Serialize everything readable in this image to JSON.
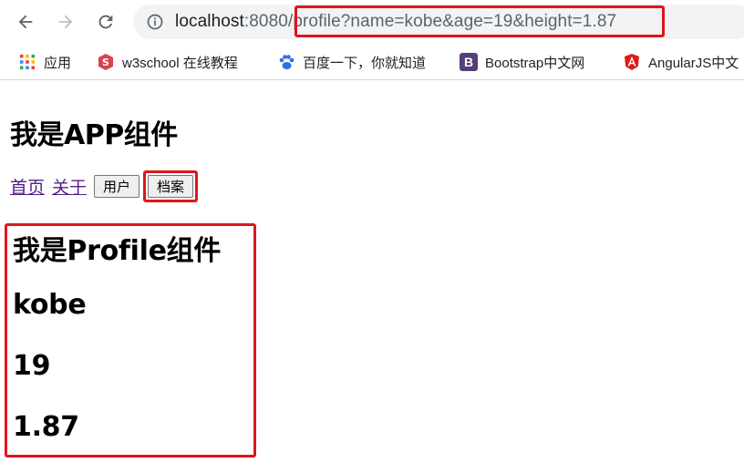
{
  "browser": {
    "url": {
      "host": "localhost",
      "port": ":8080",
      "path": "/profile?name=kobe&age=19&height=1.87"
    },
    "bookmarks": [
      {
        "label": "应用",
        "icon": "apps-grid-icon"
      },
      {
        "label": "w3school 在线教程",
        "icon": "w3school-icon"
      },
      {
        "label": "百度一下，你就知道",
        "icon": "baidu-paw-icon"
      },
      {
        "label": "Bootstrap中文网",
        "icon": "bootstrap-icon",
        "badge": "B"
      },
      {
        "label": "AngularJS中文",
        "icon": "angular-icon"
      }
    ]
  },
  "app": {
    "title": "我是APP组件",
    "nav": {
      "home": "首页",
      "about": "关于",
      "user_button": "用户",
      "profile_button": "档案"
    }
  },
  "profile": {
    "title": "我是Profile组件",
    "name": "kobe",
    "age": "19",
    "height": "1.87"
  },
  "colors": {
    "highlight": "#e0151d",
    "visited_link": "#551a8b"
  }
}
